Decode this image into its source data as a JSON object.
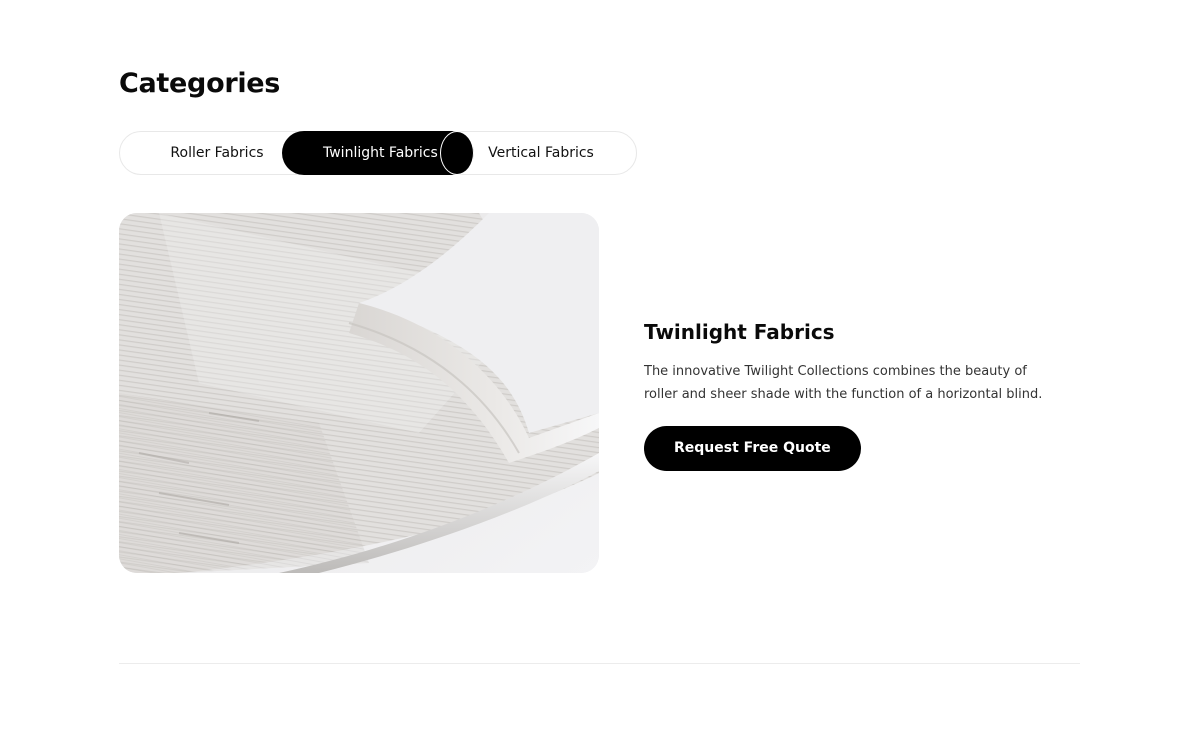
{
  "categories": {
    "title": "Categories",
    "tabs": [
      {
        "label": "Roller Fabrics",
        "active": false
      },
      {
        "label": "Twinlight Fabrics",
        "active": true
      },
      {
        "label": "Vertical Fabrics",
        "active": false
      }
    ]
  },
  "detail": {
    "title": "Twinlight Fabrics",
    "description": "The innovative Twilight Collections combines the beauty of roller and sheer shade with the function of a horizontal blind.",
    "button_label": "Request Free Quote"
  },
  "colors": {
    "accent": "#000000",
    "background": "#ffffff",
    "divider": "#ececec"
  }
}
